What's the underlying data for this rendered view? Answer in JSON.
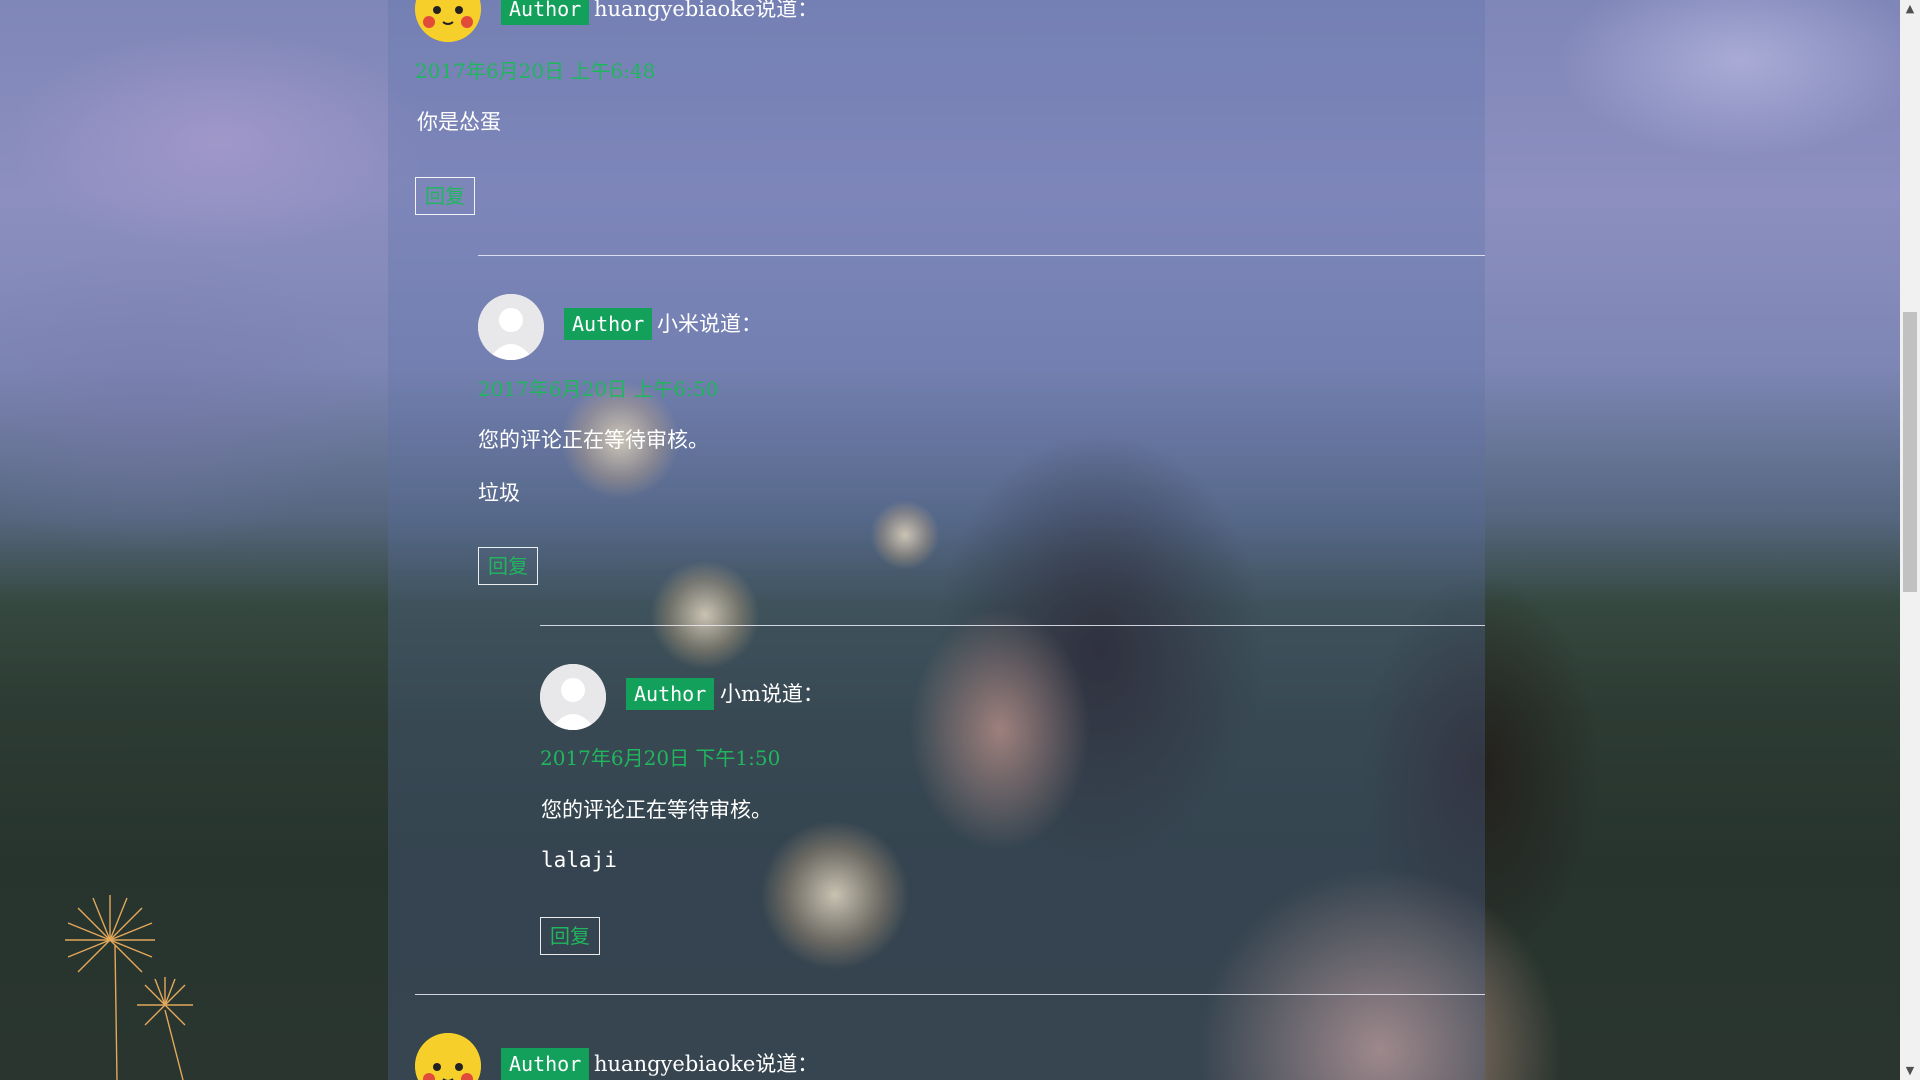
{
  "comments": [
    {
      "badge": "Author",
      "user_line": "huangyebiaoke说道：",
      "date": "2017年6月20日 上午6:48",
      "paragraphs": [
        "你是怂蛋"
      ],
      "reply_label": "回复",
      "avatar": "pikachu-avatar"
    },
    {
      "badge": "Author",
      "user_line": "小米说道：",
      "date": "2017年6月20日 上午6:50",
      "paragraphs": [
        "您的评论正在等待审核。",
        "垃圾"
      ],
      "reply_label": "回复",
      "avatar": "default-user-avatar"
    },
    {
      "badge": "Author",
      "user_line": "小m说道：",
      "date": "2017年6月20日 下午1:50",
      "paragraphs": [
        "您的评论正在等待审核。",
        "lalaji"
      ],
      "reply_label": "回复",
      "avatar": "default-user-avatar"
    },
    {
      "badge": "Author",
      "user_line": "huangyebiaoke说道：",
      "avatar": "pikachu-avatar"
    }
  ],
  "colors": {
    "badge_bg": "#12a05a",
    "date_text": "#1fb65d",
    "body_text": "#ffffff"
  }
}
